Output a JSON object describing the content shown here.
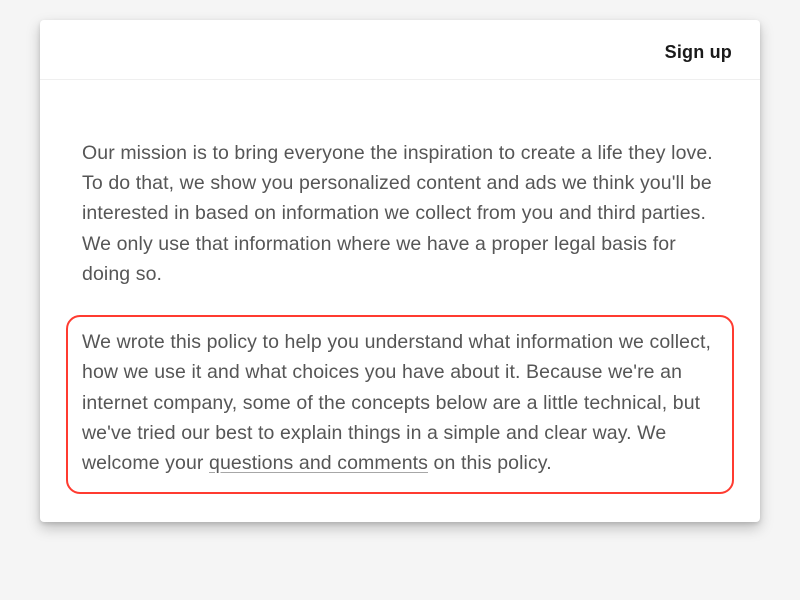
{
  "header": {
    "signup_label": "Sign up"
  },
  "content": {
    "para1": "Our mission is to bring everyone the inspiration to create a life they love. To do that, we show you personalized content and ads we think you'll be interested in based on information we collect from you and third parties. We only use that information where we have a proper legal basis for doing so.",
    "para2_lead": "We wrote this policy to help you understand what information we collect, how we use it and what choices you have about it. Because we're an internet company, some of the concepts below are a little technical, but we've tried our best to explain things in a simple and clear way. We welcome your ",
    "para2_link": "questions and comments",
    "para2_tail": " on this policy."
  },
  "colors": {
    "highlight_border": "#ff3b30",
    "text": "#565656"
  }
}
